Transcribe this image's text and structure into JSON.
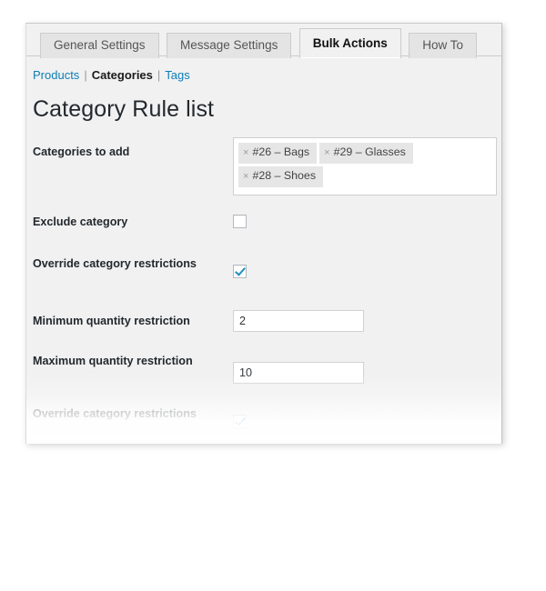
{
  "tabs": [
    {
      "label": "General Settings",
      "active": false
    },
    {
      "label": "Message Settings",
      "active": false
    },
    {
      "label": "Bulk Actions",
      "active": true
    },
    {
      "label": "How To",
      "active": false
    }
  ],
  "breadcrumb": {
    "items": [
      {
        "label": "Products",
        "current": false
      },
      {
        "label": "Categories",
        "current": true
      },
      {
        "label": "Tags",
        "current": false
      }
    ],
    "separator": "|"
  },
  "page_title": "Category Rule list",
  "form": {
    "rows": [
      {
        "label": "Categories to add",
        "type": "multiselect",
        "chips": [
          {
            "remove_icon": "×",
            "label": "#26 – Bags"
          },
          {
            "remove_icon": "×",
            "label": "#29 – Glasses"
          },
          {
            "remove_icon": "×",
            "label": "#28 – Shoes"
          }
        ]
      },
      {
        "label": "Exclude category",
        "type": "checkbox",
        "checked": false
      },
      {
        "label": "Override category restrictions",
        "type": "checkbox",
        "checked": true
      },
      {
        "label": "Minimum quantity restriction",
        "type": "text",
        "value": "2",
        "placeholder": ""
      },
      {
        "label": "Maximum quantity restriction",
        "type": "text",
        "value": "10",
        "placeholder": ""
      },
      {
        "label": "Override category restrictions",
        "type": "checkbox",
        "checked": true
      }
    ]
  },
  "colors": {
    "accent_link": "#0b7eb5",
    "checkbox_check": "#1e8cbe",
    "panel_bg": "#f1f1f1",
    "tab_inactive_bg": "#e4e4e4",
    "chip_bg": "#e6e6e6"
  }
}
